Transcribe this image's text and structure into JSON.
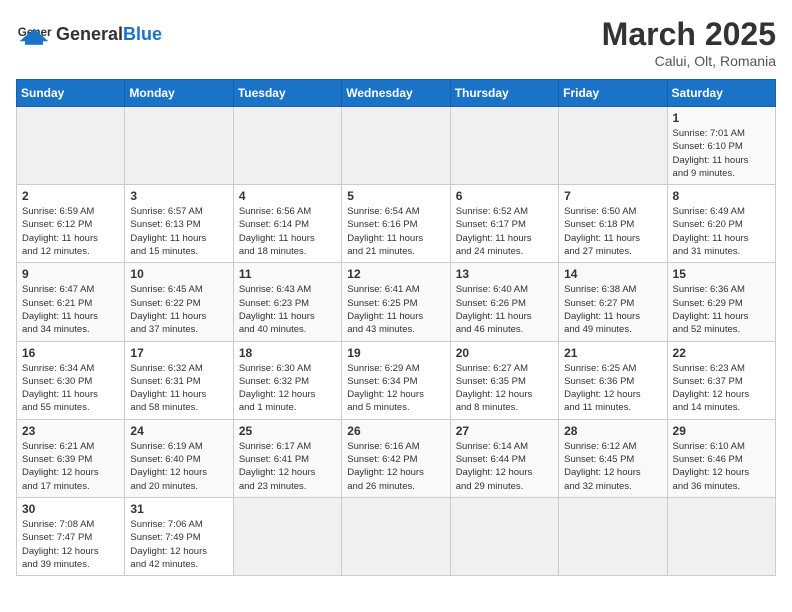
{
  "header": {
    "logo_general": "General",
    "logo_blue": "Blue",
    "month_year": "March 2025",
    "location": "Calui, Olt, Romania"
  },
  "days_of_week": [
    "Sunday",
    "Monday",
    "Tuesday",
    "Wednesday",
    "Thursday",
    "Friday",
    "Saturday"
  ],
  "weeks": [
    [
      {
        "day": "",
        "info": ""
      },
      {
        "day": "",
        "info": ""
      },
      {
        "day": "",
        "info": ""
      },
      {
        "day": "",
        "info": ""
      },
      {
        "day": "",
        "info": ""
      },
      {
        "day": "",
        "info": ""
      },
      {
        "day": "1",
        "info": "Sunrise: 7:01 AM\nSunset: 6:10 PM\nDaylight: 11 hours\nand 9 minutes."
      }
    ],
    [
      {
        "day": "2",
        "info": "Sunrise: 6:59 AM\nSunset: 6:12 PM\nDaylight: 11 hours\nand 12 minutes."
      },
      {
        "day": "3",
        "info": "Sunrise: 6:57 AM\nSunset: 6:13 PM\nDaylight: 11 hours\nand 15 minutes."
      },
      {
        "day": "4",
        "info": "Sunrise: 6:56 AM\nSunset: 6:14 PM\nDaylight: 11 hours\nand 18 minutes."
      },
      {
        "day": "5",
        "info": "Sunrise: 6:54 AM\nSunset: 6:16 PM\nDaylight: 11 hours\nand 21 minutes."
      },
      {
        "day": "6",
        "info": "Sunrise: 6:52 AM\nSunset: 6:17 PM\nDaylight: 11 hours\nand 24 minutes."
      },
      {
        "day": "7",
        "info": "Sunrise: 6:50 AM\nSunset: 6:18 PM\nDaylight: 11 hours\nand 27 minutes."
      },
      {
        "day": "8",
        "info": "Sunrise: 6:49 AM\nSunset: 6:20 PM\nDaylight: 11 hours\nand 31 minutes."
      }
    ],
    [
      {
        "day": "9",
        "info": "Sunrise: 6:47 AM\nSunset: 6:21 PM\nDaylight: 11 hours\nand 34 minutes."
      },
      {
        "day": "10",
        "info": "Sunrise: 6:45 AM\nSunset: 6:22 PM\nDaylight: 11 hours\nand 37 minutes."
      },
      {
        "day": "11",
        "info": "Sunrise: 6:43 AM\nSunset: 6:23 PM\nDaylight: 11 hours\nand 40 minutes."
      },
      {
        "day": "12",
        "info": "Sunrise: 6:41 AM\nSunset: 6:25 PM\nDaylight: 11 hours\nand 43 minutes."
      },
      {
        "day": "13",
        "info": "Sunrise: 6:40 AM\nSunset: 6:26 PM\nDaylight: 11 hours\nand 46 minutes."
      },
      {
        "day": "14",
        "info": "Sunrise: 6:38 AM\nSunset: 6:27 PM\nDaylight: 11 hours\nand 49 minutes."
      },
      {
        "day": "15",
        "info": "Sunrise: 6:36 AM\nSunset: 6:29 PM\nDaylight: 11 hours\nand 52 minutes."
      }
    ],
    [
      {
        "day": "16",
        "info": "Sunrise: 6:34 AM\nSunset: 6:30 PM\nDaylight: 11 hours\nand 55 minutes."
      },
      {
        "day": "17",
        "info": "Sunrise: 6:32 AM\nSunset: 6:31 PM\nDaylight: 11 hours\nand 58 minutes."
      },
      {
        "day": "18",
        "info": "Sunrise: 6:30 AM\nSunset: 6:32 PM\nDaylight: 12 hours\nand 1 minute."
      },
      {
        "day": "19",
        "info": "Sunrise: 6:29 AM\nSunset: 6:34 PM\nDaylight: 12 hours\nand 5 minutes."
      },
      {
        "day": "20",
        "info": "Sunrise: 6:27 AM\nSunset: 6:35 PM\nDaylight: 12 hours\nand 8 minutes."
      },
      {
        "day": "21",
        "info": "Sunrise: 6:25 AM\nSunset: 6:36 PM\nDaylight: 12 hours\nand 11 minutes."
      },
      {
        "day": "22",
        "info": "Sunrise: 6:23 AM\nSunset: 6:37 PM\nDaylight: 12 hours\nand 14 minutes."
      }
    ],
    [
      {
        "day": "23",
        "info": "Sunrise: 6:21 AM\nSunset: 6:39 PM\nDaylight: 12 hours\nand 17 minutes."
      },
      {
        "day": "24",
        "info": "Sunrise: 6:19 AM\nSunset: 6:40 PM\nDaylight: 12 hours\nand 20 minutes."
      },
      {
        "day": "25",
        "info": "Sunrise: 6:17 AM\nSunset: 6:41 PM\nDaylight: 12 hours\nand 23 minutes."
      },
      {
        "day": "26",
        "info": "Sunrise: 6:16 AM\nSunset: 6:42 PM\nDaylight: 12 hours\nand 26 minutes."
      },
      {
        "day": "27",
        "info": "Sunrise: 6:14 AM\nSunset: 6:44 PM\nDaylight: 12 hours\nand 29 minutes."
      },
      {
        "day": "28",
        "info": "Sunrise: 6:12 AM\nSunset: 6:45 PM\nDaylight: 12 hours\nand 32 minutes."
      },
      {
        "day": "29",
        "info": "Sunrise: 6:10 AM\nSunset: 6:46 PM\nDaylight: 12 hours\nand 36 minutes."
      }
    ],
    [
      {
        "day": "30",
        "info": "Sunrise: 7:08 AM\nSunset: 7:47 PM\nDaylight: 12 hours\nand 39 minutes."
      },
      {
        "day": "31",
        "info": "Sunrise: 7:06 AM\nSunset: 7:49 PM\nDaylight: 12 hours\nand 42 minutes."
      },
      {
        "day": "",
        "info": ""
      },
      {
        "day": "",
        "info": ""
      },
      {
        "day": "",
        "info": ""
      },
      {
        "day": "",
        "info": ""
      },
      {
        "day": "",
        "info": ""
      }
    ]
  ]
}
